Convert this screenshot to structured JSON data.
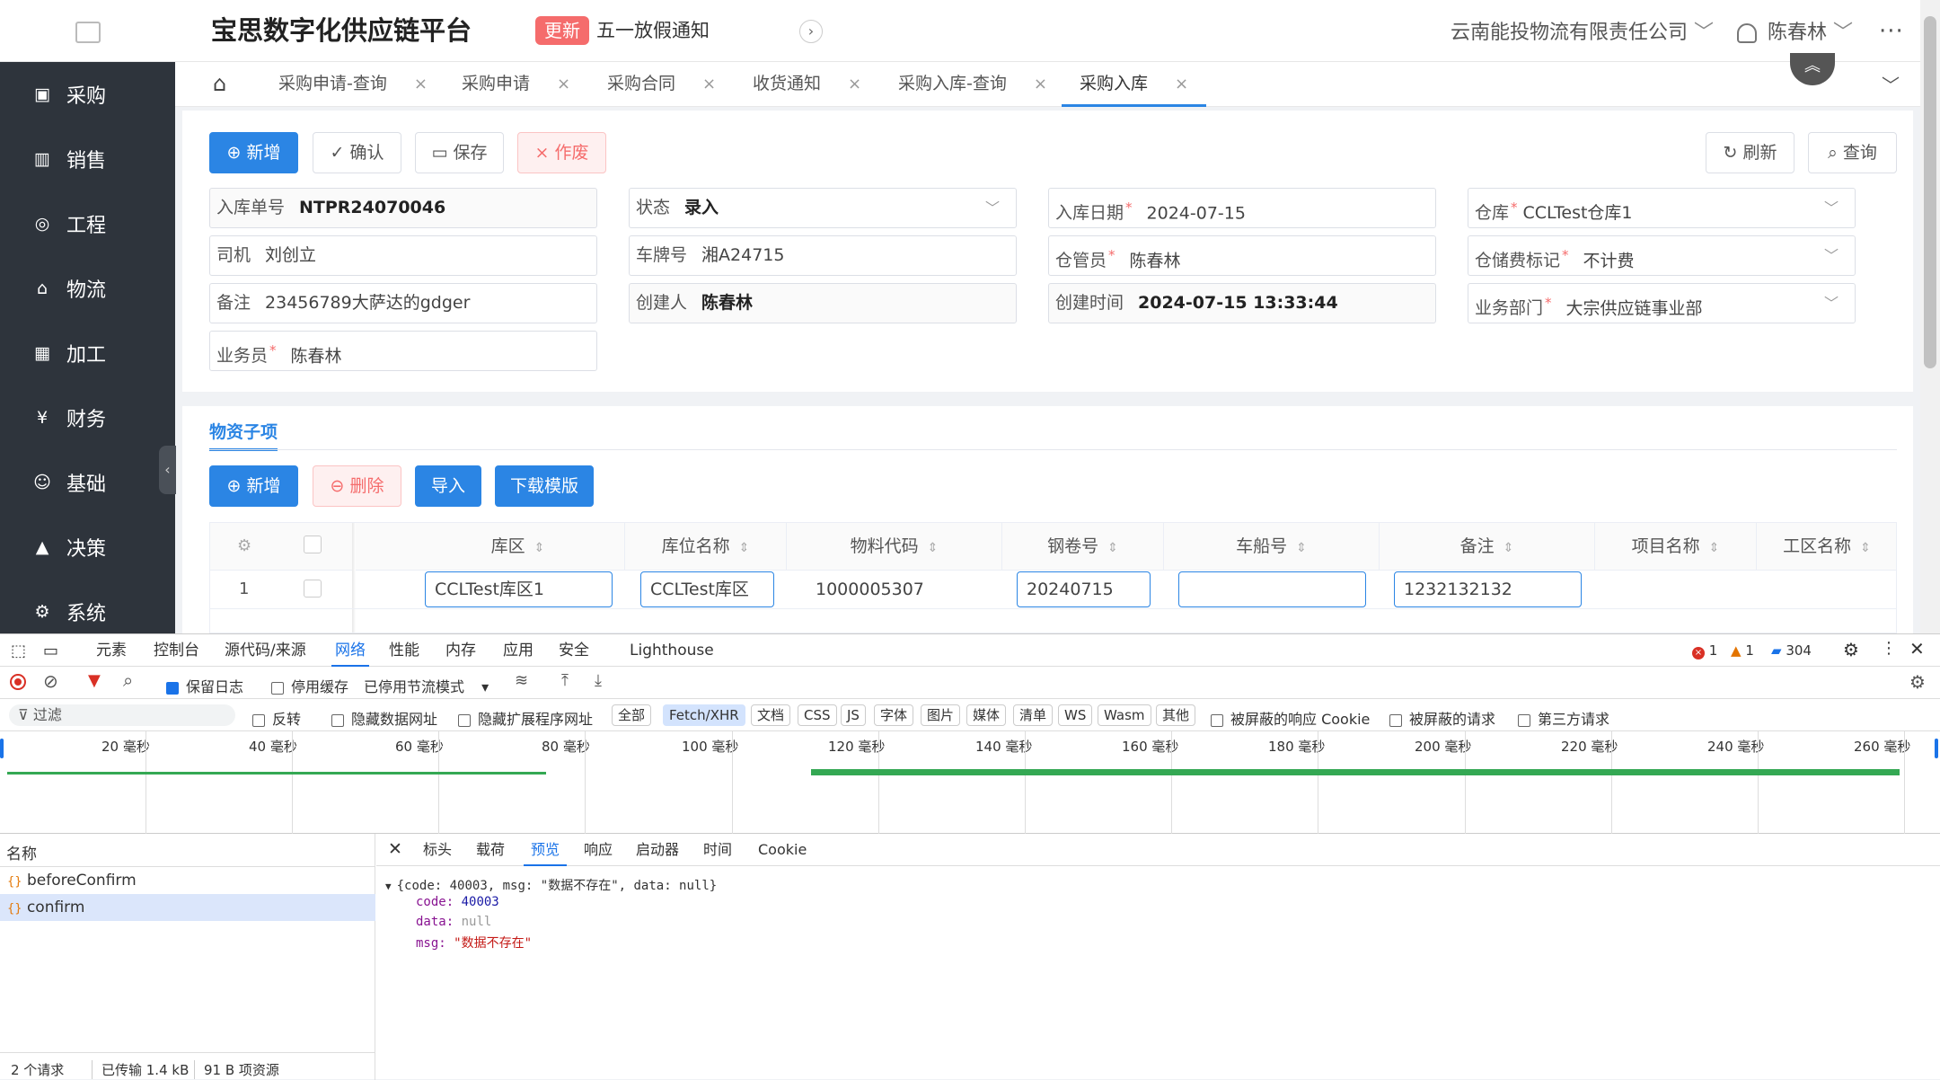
{
  "header": {
    "brand": "宝思数字化供应链平台",
    "badge": "更新",
    "notice": "五一放假通知",
    "company": "云南能投物流有限责任公司",
    "user": "陈春林"
  },
  "sidebar": {
    "items": [
      {
        "label": "采购",
        "icon": "calendar-icon"
      },
      {
        "label": "销售",
        "icon": "bar-chart-icon"
      },
      {
        "label": "工程",
        "icon": "compass-icon"
      },
      {
        "label": "物流",
        "icon": "home-icon"
      },
      {
        "label": "加工",
        "icon": "calendar-icon"
      },
      {
        "label": "财务",
        "icon": "yen-icon"
      },
      {
        "label": "基础",
        "icon": "smile-icon"
      },
      {
        "label": "决策",
        "icon": "area-chart-icon"
      },
      {
        "label": "系统",
        "icon": "gear-icon"
      }
    ]
  },
  "tabs": [
    {
      "label": "采购申请-查询"
    },
    {
      "label": "采购申请"
    },
    {
      "label": "采购合同"
    },
    {
      "label": "收货通知"
    },
    {
      "label": "采购入库-查询"
    },
    {
      "label": "采购入库"
    }
  ],
  "toolbar": {
    "add": "新增",
    "confirm": "确认",
    "save": "保存",
    "void": "作废",
    "refresh": "刷新",
    "query": "查询"
  },
  "form": {
    "order_no": {
      "label": "入库单号",
      "value": "NTPR24070046"
    },
    "status": {
      "label": "状态",
      "value": "录入"
    },
    "date": {
      "label": "入库日期",
      "value": "2024-07-15"
    },
    "warehouse": {
      "label": "仓库",
      "value": "CCLTest仓库1"
    },
    "driver": {
      "label": "司机",
      "value": "刘创立"
    },
    "plate": {
      "label": "车牌号",
      "value": "湘A24715"
    },
    "keeper": {
      "label": "仓管员",
      "value": "陈春林"
    },
    "fee_flag": {
      "label": "仓储费标记",
      "value": "不计费"
    },
    "remark": {
      "label": "备注",
      "value": "23456789大萨达的gdger"
    },
    "creator": {
      "label": "创建人",
      "value": "陈春林"
    },
    "created": {
      "label": "创建时间",
      "value": "2024-07-15 13:33:44"
    },
    "dept": {
      "label": "业务部门",
      "value": "大宗供应链事业部"
    },
    "salesman": {
      "label": "业务员",
      "value": "陈春林"
    }
  },
  "items": {
    "section_title": "物资子项",
    "add": "新增",
    "delete": "删除",
    "import": "导入",
    "template": "下载模版",
    "columns": [
      "库区",
      "库位名称",
      "物料代码",
      "钢卷号",
      "车船号",
      "备注",
      "项目名称",
      "工区名称"
    ],
    "row": {
      "index": "1",
      "area": "CCLTest库区1",
      "location": "CCLTest库区",
      "code": "1000005307",
      "coil": "20240715",
      "ship": "",
      "remark": "1232132132"
    }
  },
  "devtools": {
    "tabs": [
      "元素",
      "控制台",
      "源代码/来源",
      "网络",
      "性能",
      "内存",
      "应用",
      "安全",
      "Lighthouse"
    ],
    "errors": "1",
    "warnings": "1",
    "messages": "304",
    "preserve_log": "保留日志",
    "disable_cache": "停用缓存",
    "throttle": "已停用节流模式",
    "filter": "过滤",
    "invert": "反转",
    "hide_data": "隐藏数据网址",
    "hide_ext": "隐藏扩展程序网址",
    "types": [
      "全部",
      "Fetch/XHR",
      "文档",
      "CSS",
      "JS",
      "字体",
      "图片",
      "媒体",
      "清单",
      "WS",
      "Wasm",
      "其他"
    ],
    "blocked_cookies": "被屏蔽的响应 Cookie",
    "blocked_req": "被屏蔽的请求",
    "third_party": "第三方请求",
    "ticks": [
      "20 毫秒",
      "40 毫秒",
      "60 毫秒",
      "80 毫秒",
      "100 毫秒",
      "120 毫秒",
      "140 毫秒",
      "160 毫秒",
      "180 毫秒",
      "200 毫秒",
      "220 毫秒",
      "240 毫秒",
      "260 毫秒"
    ],
    "name_header": "名称",
    "requests": [
      "beforeConfirm",
      "confirm"
    ],
    "detail_tabs": [
      "标头",
      "载荷",
      "预览",
      "响应",
      "启动器",
      "时间",
      "Cookie"
    ],
    "preview": {
      "summary": "{code: 40003, msg: \"数据不存在\", data: null}",
      "code_key": "code:",
      "code_val": "40003",
      "data_key": "data:",
      "data_val": "null",
      "msg_key": "msg:",
      "msg_val": "\"数据不存在\""
    },
    "status": {
      "count": "2 个请求",
      "transferred": "已传输 1.4 kB",
      "resources": "91 B 项资源"
    }
  }
}
